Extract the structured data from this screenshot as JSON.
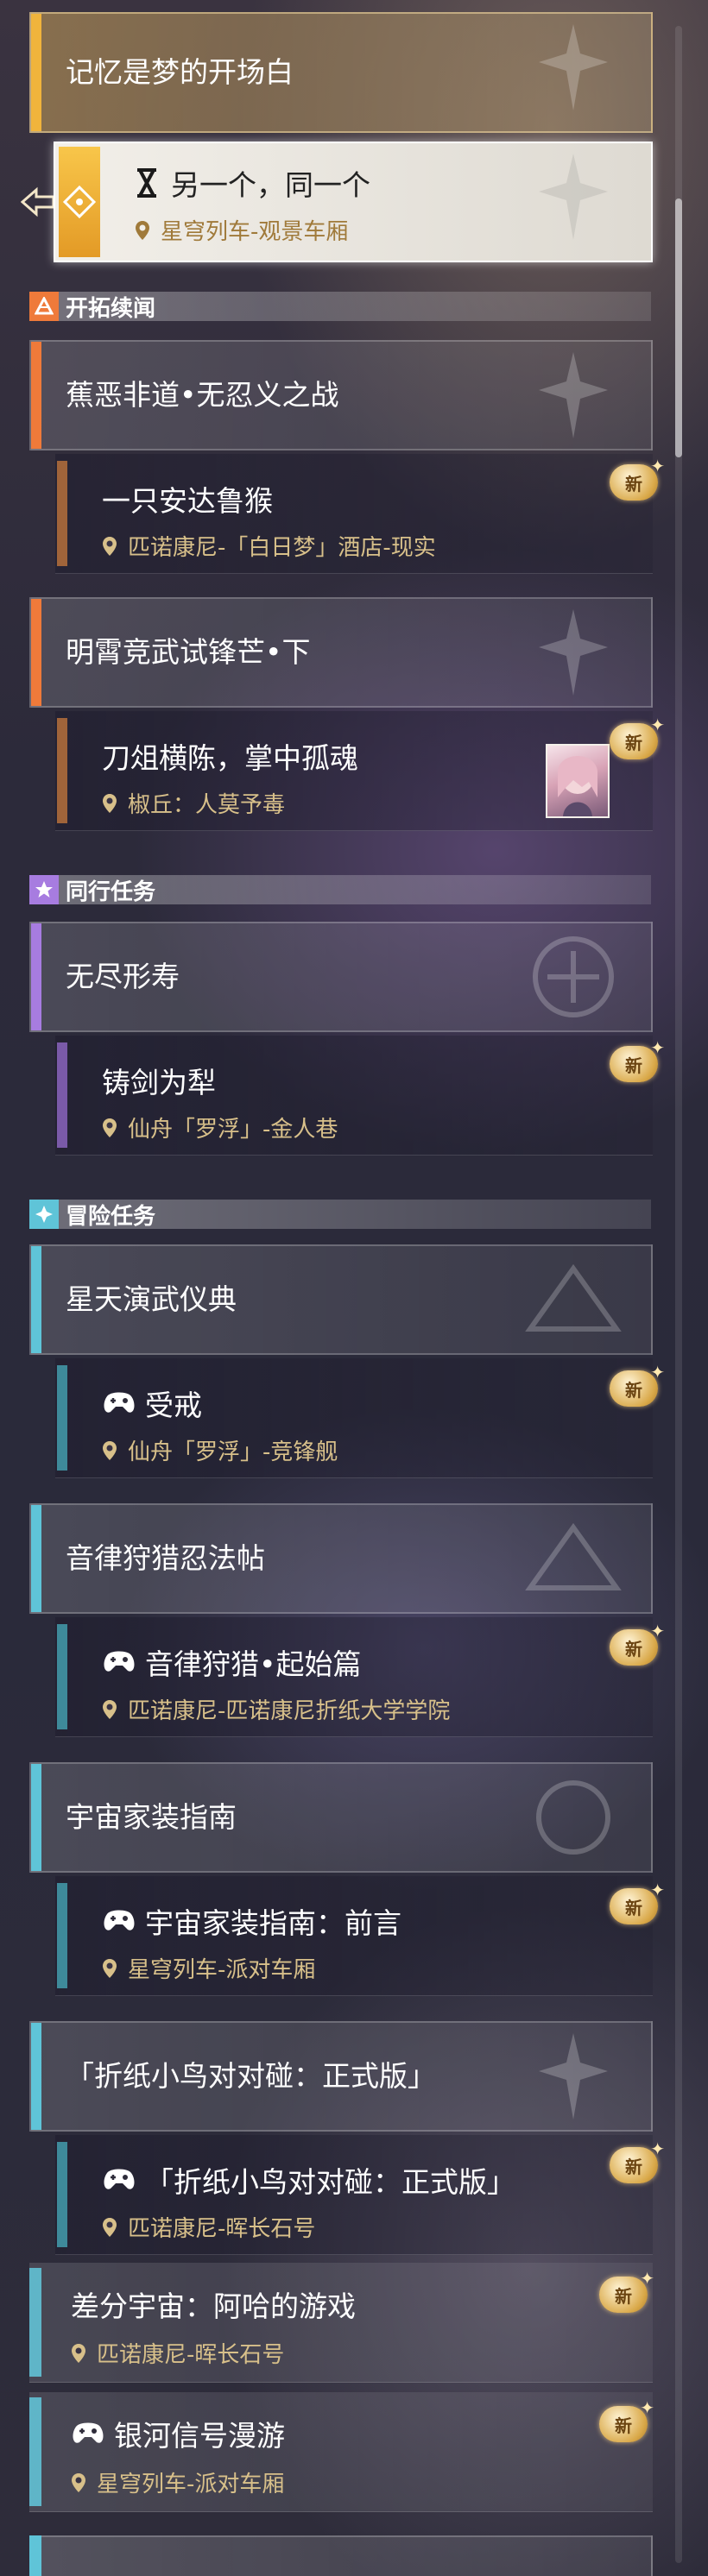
{
  "top": {
    "main_quest_title": "记忆是梦的开场白",
    "selected_quest": {
      "title": "另一个，同一个",
      "location": "星穹列车-观景车厢"
    }
  },
  "sections": {
    "trailblaze": {
      "title": "开拓续闻"
    },
    "companion": {
      "title": "同行任务"
    },
    "adventure": {
      "title": "冒险任务"
    }
  },
  "new_badge_label": "新",
  "quests": {
    "q1": {
      "title": "蕉恶非道•无忍义之战"
    },
    "q1t1": {
      "name": "一只安达鲁猴",
      "location": "匹诺康尼-「白日梦」酒店-现实"
    },
    "q2": {
      "title": "明霄竞武试锋芒•下"
    },
    "q2t1": {
      "name": "刀俎横陈，掌中孤魂",
      "location": "椒丘：人莫予毒"
    },
    "q3": {
      "title": "无尽形寿"
    },
    "q3t1": {
      "name": "铸剑为犁",
      "location": "仙舟「罗浮」-金人巷"
    },
    "q4": {
      "title": "星天演武仪典"
    },
    "q4t1": {
      "name": "受戒",
      "location": "仙舟「罗浮」-竞锋舰"
    },
    "q5": {
      "title": "音律狩猎忍法帖"
    },
    "q5t1": {
      "name": "音律狩猎•起始篇",
      "location": "匹诺康尼-匹诺康尼折纸大学学院"
    },
    "q6": {
      "title": "宇宙家装指南"
    },
    "q6t1": {
      "name": "宇宙家装指南：前言",
      "location": "星穹列车-派对车厢"
    },
    "q7": {
      "title": "「折纸小鸟对对碰：正式版」"
    },
    "q7t1": {
      "name": "「折纸小鸟对对碰：正式版」",
      "location": "匹诺康尼-晖长石号"
    },
    "s1": {
      "name": "差分宇宙：阿哈的游戏",
      "location": "匹诺康尼-晖长石号"
    },
    "s2": {
      "name": "银河信号漫游",
      "location": "星穹列车-派对车厢"
    }
  },
  "colors": {
    "gold": "#f0b43c",
    "trailblaze_accent": "#ef7a3a",
    "trailblaze_bar": "#a0643a",
    "companion_accent": "#a77ce0",
    "companion_bar": "#7a5aa8",
    "adventure_accent": "#5fc4d8",
    "adventure_bar": "#3e8a9a",
    "location_text": "#d8c08a"
  },
  "icons": {
    "tracking": "target-arrow-icon",
    "hourglass": "hourglass-icon",
    "pin": "location-pin-icon",
    "game": "gamepad-icon",
    "new": "new-badge-icon"
  }
}
